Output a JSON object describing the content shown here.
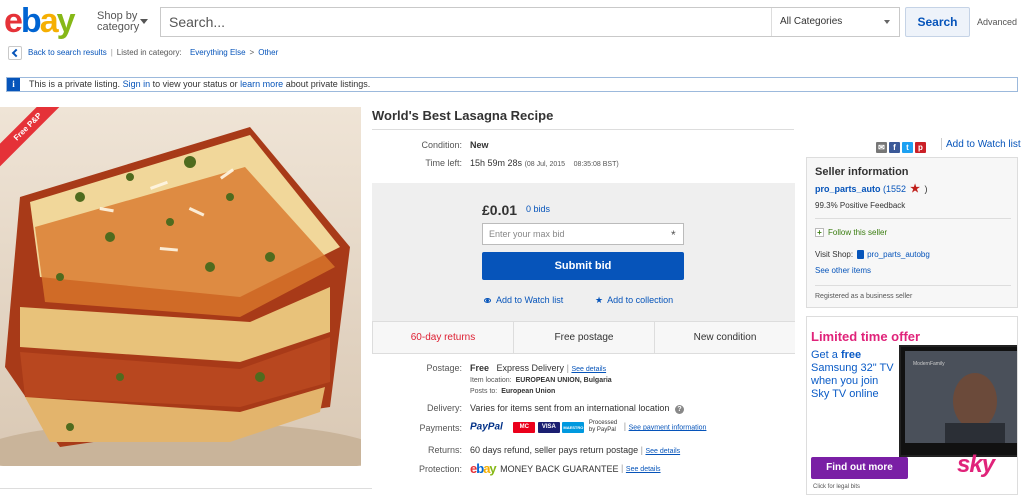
{
  "header": {
    "logo": {
      "e": "e",
      "b": "b",
      "a": "a",
      "y": "y"
    },
    "shop_by_line1": "Shop by",
    "shop_by_line2": "category",
    "search_placeholder": "Search...",
    "category_select": "All Categories",
    "search_button": "Search",
    "advanced": "Advanced"
  },
  "breadcrumb": {
    "back": "Back to search results",
    "listed_in": "Listed in category:",
    "cat1": "Everything Else",
    "separator": ">",
    "cat2": "Other"
  },
  "notice": {
    "icon": "i",
    "text_before": "This is a private listing.",
    "sign_in": "Sign in",
    "text_middle": "to view your status or",
    "learn_more": "learn more",
    "text_after": "about private listings."
  },
  "image": {
    "ribbon": "Free P&P"
  },
  "listing": {
    "title": "World's Best Lasagna Recipe",
    "condition_label": "Condition:",
    "condition_value": "New",
    "time_left_label": "Time left:",
    "time_left_value": "15h 59m 28s",
    "time_left_date": "(08 Jul, 2015",
    "time_left_time": "08:35:08 BST)",
    "add_to_watch_list": "Add to Watch list"
  },
  "share": {
    "email_icon": "email-icon",
    "facebook": "f",
    "twitter": "t",
    "pinterest": "p"
  },
  "bid": {
    "price": "£0.01",
    "bids": "0 bids",
    "max_bid_placeholder": "Enter your max bid",
    "required": "*",
    "submit": "Submit bid",
    "watch": "Add to Watch list",
    "collection": "Add to collection"
  },
  "features": {
    "returns": "60-day returns",
    "postage": "Free postage",
    "condition": "New condition"
  },
  "details": {
    "postage_label": "Postage:",
    "postage_free": "Free",
    "postage_method": "Express Delivery",
    "see_details": "See details",
    "item_location_label": "Item location:",
    "item_location": "EUROPEAN UNION, Bulgaria",
    "posts_to_label": "Posts to:",
    "posts_to": "European Union",
    "delivery_label": "Delivery:",
    "delivery_value": "Varies for items sent from an international location",
    "payments_label": "Payments:",
    "paypal": "PayPal",
    "card1": "MC",
    "card2": "VISA",
    "card3": "MAESTRO",
    "processed_line1": "Processed",
    "processed_line2": "by PayPal",
    "see_payment": "See payment information",
    "returns_label": "Returns:",
    "returns_value": "60 days refund, seller pays return postage",
    "protection_label": "Protection:",
    "protection_value": "MONEY BACK GUARANTEE"
  },
  "seller": {
    "heading": "Seller information",
    "name": "pro_parts_auto",
    "score": "(1552",
    "score_close": ")",
    "feedback": "99.3% Positive Feedback",
    "follow": "Follow this seller",
    "visit_shop": "Visit Shop:",
    "shop_name": "pro_parts_autobg",
    "see_other": "See other items",
    "registered": "Registered as a business seller"
  },
  "ad": {
    "headline": "Limited time offer",
    "line1": "Get a",
    "free": "free",
    "line2": "Samsung 32\" TV",
    "line3": "when you join",
    "line4": "Sky TV online",
    "button": "Find out more",
    "brand": "sky",
    "legal": "Click for legal bits",
    "tv_brand": "ModernFamily"
  },
  "colors": {
    "link": "#0654ba",
    "primary_button": "#0654ba",
    "returns_red": "#dd1e31",
    "ribbon_red": "#e53238",
    "ad_pink": "#e0237a",
    "ad_purple": "#7a1fa5"
  }
}
